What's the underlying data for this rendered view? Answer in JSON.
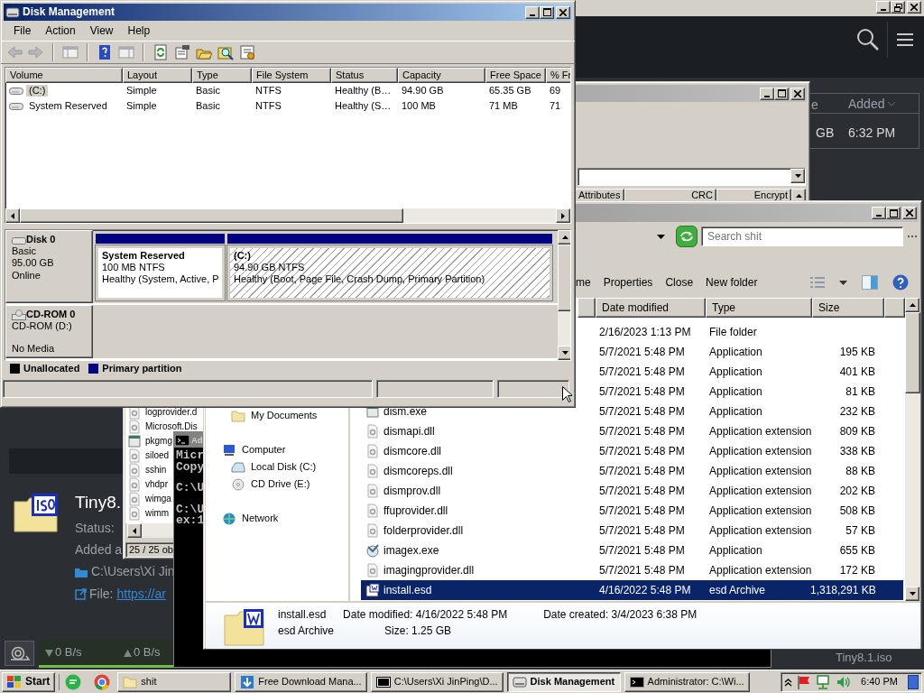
{
  "download_manager": {
    "columns": [
      "e",
      "Added"
    ],
    "row": [
      "GB",
      "6:32 PM"
    ],
    "item": {
      "name": "Tiny8.",
      "status": "Status:",
      "added": "Added a",
      "path": "C:\\Users\\Xi Jin",
      "file_label": "File:",
      "link": "https://ar"
    },
    "speeds": {
      "down": "0 B/s",
      "up": "0 B/s"
    },
    "current_file": "Tiny8.1.iso"
  },
  "archive_manager": {
    "columns": [
      "Attributes",
      "CRC",
      "Encrypt"
    ],
    "files": [
      {
        "name": "logprovider.d",
        "kind": "dll"
      },
      {
        "name": "Microsoft.Dis",
        "kind": "dll"
      },
      {
        "name": "pkgmg",
        "kind": "app"
      },
      {
        "name": "siloed",
        "kind": "dll"
      },
      {
        "name": "sshin",
        "kind": "dll"
      },
      {
        "name": "vhdpr",
        "kind": "dll"
      },
      {
        "name": "wimga",
        "kind": "dll"
      },
      {
        "name": "wimm",
        "kind": "dll"
      }
    ],
    "status": "25 / 25 ob"
  },
  "console": {
    "title": "Ad",
    "blocks": [
      [
        "Micr",
        "Copy"
      ],
      [
        "C:\\U"
      ],
      [
        "C:\\U",
        "ex:1"
      ]
    ]
  },
  "explorer": {
    "search": {
      "placeholder": "Search shit"
    },
    "toolbar": [
      "me",
      "Properties",
      "Close",
      "New folder"
    ],
    "columns": [
      "Date modified",
      "Type",
      "Size"
    ],
    "nav": [
      {
        "label": "My Documents",
        "kind": "folder"
      },
      {
        "label": "Computer",
        "kind": "computer",
        "children": [
          {
            "label": "Local Disk (C:)",
            "kind": "disk"
          },
          {
            "label": "CD Drive (E:)",
            "kind": "cd"
          }
        ]
      },
      {
        "label": "Network",
        "kind": "network"
      }
    ],
    "rows": [
      {
        "date": "2/16/2023 1:13 PM",
        "type": "File folder",
        "size": "",
        "selected": false
      },
      {
        "date": "5/7/2021 5:48 PM",
        "type": "Application",
        "size": "195 KB",
        "selected": false
      },
      {
        "date": "5/7/2021 5:48 PM",
        "type": "Application",
        "size": "401 KB",
        "selected": false
      },
      {
        "date": "5/7/2021 5:48 PM",
        "type": "Application",
        "size": "81 KB",
        "selected": false
      },
      {
        "name": "dism.exe",
        "kind": "app",
        "date": "5/7/2021 5:48 PM",
        "type": "Application",
        "size": "232 KB",
        "selected": false
      },
      {
        "name": "dismapi.dll",
        "kind": "dll",
        "date": "5/7/2021 5:48 PM",
        "type": "Application extension",
        "size": "809 KB",
        "selected": false
      },
      {
        "name": "dismcore.dll",
        "kind": "dll",
        "date": "5/7/2021 5:48 PM",
        "type": "Application extension",
        "size": "338 KB",
        "selected": false
      },
      {
        "name": "dismcoreps.dll",
        "kind": "dll",
        "date": "5/7/2021 5:48 PM",
        "type": "Application extension",
        "size": "88 KB",
        "selected": false
      },
      {
        "name": "dismprov.dll",
        "kind": "dll",
        "date": "5/7/2021 5:48 PM",
        "type": "Application extension",
        "size": "202 KB",
        "selected": false
      },
      {
        "name": "ffuprovider.dll",
        "kind": "dll",
        "date": "5/7/2021 5:48 PM",
        "type": "Application extension",
        "size": "508 KB",
        "selected": false
      },
      {
        "name": "folderprovider.dll",
        "kind": "dll",
        "date": "5/7/2021 5:48 PM",
        "type": "Application extension",
        "size": "57 KB",
        "selected": false
      },
      {
        "name": "imagex.exe",
        "kind": "tool",
        "date": "5/7/2021 5:48 PM",
        "type": "Application",
        "size": "655 KB",
        "selected": false
      },
      {
        "name": "imagingprovider.dll",
        "kind": "dll",
        "date": "5/7/2021 5:48 PM",
        "type": "Application extension",
        "size": "172 KB",
        "selected": false
      },
      {
        "name": "install.esd",
        "kind": "archive",
        "date": "4/16/2022 5:48 PM",
        "type": "esd Archive",
        "size": "1,318,291 KB",
        "selected": true
      }
    ],
    "details": {
      "name": "install.esd",
      "modified": "Date modified: 4/16/2022 5:48 PM",
      "created": "Date created: 3/4/2023 6:38 PM",
      "type": "esd Archive",
      "size": "Size: 1.25 GB"
    }
  },
  "disk_management": {
    "title": "Disk Management",
    "menu": [
      "File",
      "Action",
      "View",
      "Help"
    ],
    "columns": [
      "Volume",
      "Layout",
      "Type",
      "File System",
      "Status",
      "Capacity",
      "Free Space",
      "% Fr"
    ],
    "volumes": [
      {
        "cells": [
          "(C:)",
          "Simple",
          "Basic",
          "NTFS",
          "Healthy (B…",
          "94.90 GB",
          "65.35 GB",
          "69"
        ],
        "selected": true
      },
      {
        "cells": [
          "System Reserved",
          "Simple",
          "Basic",
          "NTFS",
          "Healthy (S…",
          "100 MB",
          "71 MB",
          "71"
        ],
        "selected": false
      }
    ],
    "disks": [
      {
        "name": "Disk 0",
        "kind": "hdd",
        "lines": [
          "Basic",
          "95.00 GB",
          "Online"
        ],
        "partitions": [
          {
            "name": "System Reserved",
            "size": "100 MB NTFS",
            "status": "Healthy (System, Active, P",
            "selected": false
          },
          {
            "name": "(C:)",
            "size": "94.90 GB NTFS",
            "status": "Healthy (Boot, Page File, Crash Dump, Primary Partition)",
            "selected": true
          }
        ]
      },
      {
        "name": "CD-ROM 0",
        "kind": "cd",
        "lines": [
          "CD-ROM (D:)"
        ],
        "footer": "No Media"
      }
    ],
    "legend": [
      {
        "label": "Unallocated",
        "color": "#000000"
      },
      {
        "label": "Primary partition",
        "color": "#000080"
      }
    ]
  },
  "taskbar": {
    "start": "Start",
    "items": [
      {
        "label": "shit",
        "kind": "folder",
        "selected": false
      },
      {
        "label": "Free Download Mana...",
        "kind": "download",
        "selected": false
      },
      {
        "label": "C:\\Users\\Xi JinPing\\D...",
        "kind": "archive",
        "selected": false
      },
      {
        "label": "Disk Management",
        "kind": "disk",
        "selected": true
      },
      {
        "label": "Administrator: C:\\Wi...",
        "kind": "console",
        "selected": false
      }
    ],
    "clock": "6:40 PM"
  }
}
